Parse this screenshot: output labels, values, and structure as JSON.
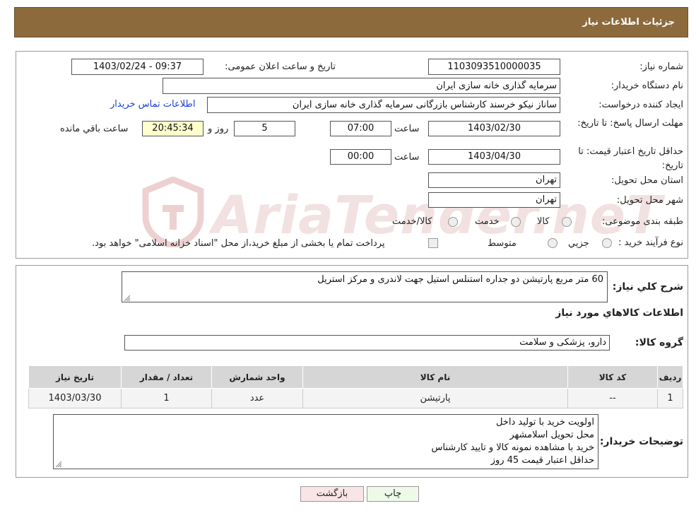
{
  "header": {
    "title": "جزئیات اطلاعات نیاز"
  },
  "form": {
    "need_number_label": "شماره نیاز:",
    "need_number": "1103093510000035",
    "announce_label": "تاریخ و ساعت اعلان عمومی:",
    "announce_value": "1403/02/24 - 09:37",
    "buyer_org_label": "نام دستگاه خریدار:",
    "buyer_org": "سرمایه گذاری خانه سازی ایران",
    "creator_label": "ایجاد کننده درخواست:",
    "creator": "ساناز نیکو خرسند کارشناس بازرگانی سرمایه گذاری خانه سازی ایران",
    "contact_link": "اطلاعات تماس خریدار",
    "deadline_label": "مهلت ارسال پاسخ: تا تاریخ:",
    "deadline_date": "1403/02/30",
    "time_label": "ساعت",
    "deadline_time": "07:00",
    "days": "5",
    "days_label": "روز و",
    "remaining": "20:45:34",
    "remaining_label": "ساعت باقي مانده",
    "validity_label": "حداقل تاریخ اعتبار قیمت: تا تاریخ:",
    "validity_date": "1403/04/30",
    "validity_time": "00:00",
    "province_label": "استان محل تحویل:",
    "province": "تهران",
    "city_label": "شهر محل تحویل:",
    "city": "تهران",
    "category_label": "طبقه بندی موضوعی:",
    "category_options": [
      "کالا",
      "خدمت",
      "کالا/خدمت"
    ],
    "purchase_label": "نوع فرآیند خرید :",
    "purchase_options": [
      "جزیي",
      "متوسط"
    ],
    "payment_note": "پرداخت تمام یا بخشی از مبلغ خرید،از محل \"اسناد خزانه اسلامی\" خواهد بود."
  },
  "watermark": "AriaTender.neT",
  "details": {
    "summary_label": "شرح کلي نياز:",
    "summary": "60 متر مربع پارتیشن دو جداره استنلس استیل جهت لاندری و مرکز استریل",
    "goods_title": "اطلاعات کالاهاي مورد نياز",
    "group_label": "گروه کالا:",
    "group": "دارو، پزشکی و سلامت",
    "table": {
      "headers": [
        "رديف",
        "کد کالا",
        "نام کالا",
        "واحد شمارش",
        "تعداد / مقدار",
        "تاريخ نياز"
      ],
      "rows": [
        [
          "1",
          "--",
          "پارتیشن",
          "عدد",
          "1",
          "1403/03/30"
        ]
      ]
    },
    "notes_label": "توضیحات خریدار:",
    "notes": [
      "اولویت خرید با تولید داخل",
      "محل تحویل اسلامشهر",
      "خرید با مشاهده نمونه کالا و تایید کارشناس",
      " حداقل اعتبار قیمت 45 روز"
    ]
  },
  "buttons": {
    "print": "چاپ",
    "back": "بازگشت"
  }
}
